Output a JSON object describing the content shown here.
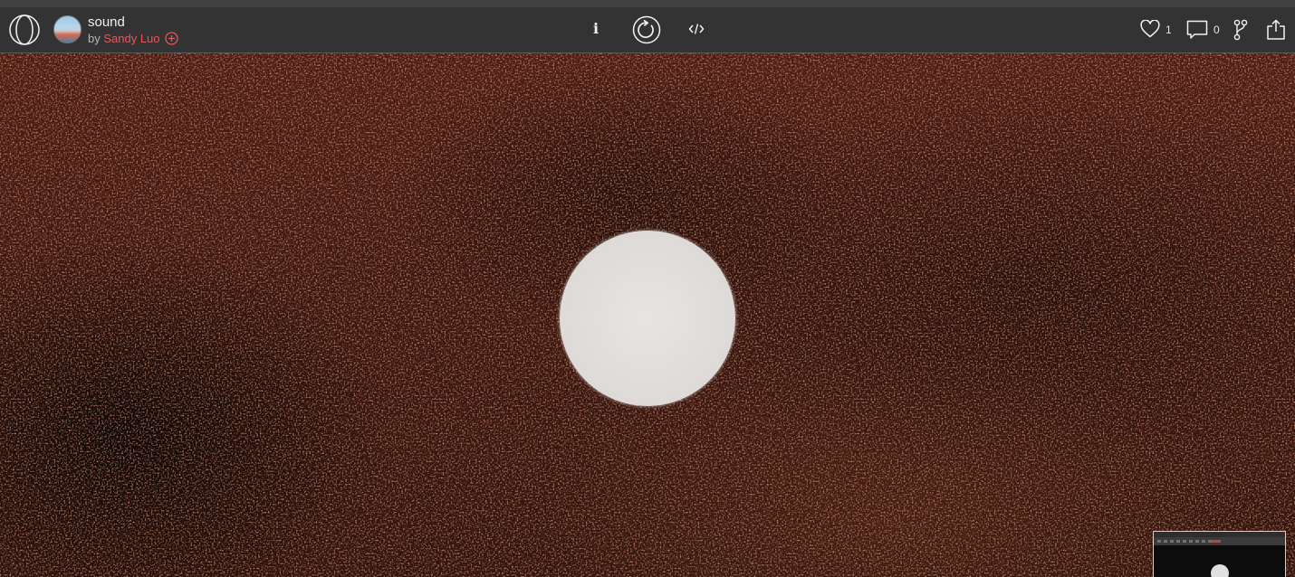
{
  "header": {
    "title": "sound",
    "by_prefix": "by",
    "author": "Sandy Luo",
    "info_label": "i",
    "like_count": "1",
    "comment_count": "0"
  },
  "icons": {
    "logo": "openprocessing-logo-icon",
    "follow": "plus-circle-icon",
    "restart": "restart-icon",
    "code": "code-icon",
    "like": "heart-icon",
    "comment": "comment-icon",
    "fork": "fork-icon",
    "share": "share-icon"
  },
  "colors": {
    "toolbar_bg": "#333333",
    "author": "#e8565e",
    "canvas_base": "#3b160e",
    "orb": "#e2dfdd"
  }
}
